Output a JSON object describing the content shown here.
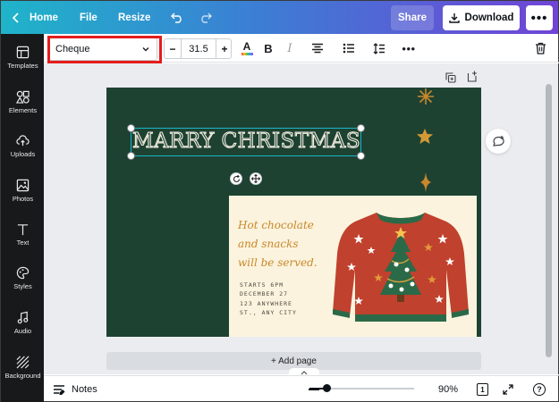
{
  "topbar": {
    "home_label": "Home",
    "file_label": "File",
    "resize_label": "Resize",
    "share_label": "Share",
    "download_label": "Download",
    "more_label": "•••"
  },
  "sidebar": {
    "items": [
      {
        "label": "Templates",
        "icon": "templates-icon"
      },
      {
        "label": "Elements",
        "icon": "elements-icon"
      },
      {
        "label": "Uploads",
        "icon": "upload-cloud-icon"
      },
      {
        "label": "Photos",
        "icon": "photo-icon"
      },
      {
        "label": "Text",
        "icon": "text-icon"
      },
      {
        "label": "Styles",
        "icon": "palette-icon"
      },
      {
        "label": "Audio",
        "icon": "music-note-icon"
      },
      {
        "label": "Background",
        "icon": "background-hatch-icon"
      }
    ]
  },
  "toolbar": {
    "font_name": "Cheque",
    "font_size": "31.5",
    "minus_label": "−",
    "plus_label": "+",
    "bold_label": "B",
    "italic_label": "I",
    "text_color_letter": "A",
    "more_label": "•••"
  },
  "design": {
    "title": "MARRY CHRISTMAS",
    "script_text": "Hot chocolate\nand snacks\nwill be served.",
    "details": "STARTS 6PM\nDECEMBER 27\n123 ANYWHERE\nST., ANY CITY",
    "colors": {
      "background": "#1e4232",
      "card": "#fbf3dd",
      "accent": "#c8882b",
      "selection": "#19b6c9"
    }
  },
  "canvas": {
    "add_page_label": "+ Add page"
  },
  "footer": {
    "notes_label": "Notes",
    "zoom_label": "90%",
    "page_count": "1",
    "help_label": "?",
    "zoom_percent": 90
  },
  "highlight_color": "#e41d1d"
}
